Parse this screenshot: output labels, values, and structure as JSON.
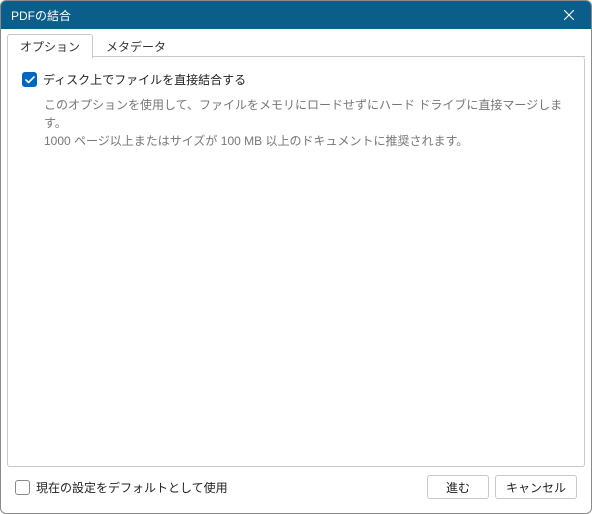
{
  "titlebar": {
    "title": "PDFの結合"
  },
  "tabs": {
    "active": 0,
    "items": [
      {
        "label": "オプション"
      },
      {
        "label": "メタデータ"
      }
    ]
  },
  "options": {
    "direct_merge": {
      "checked": true,
      "label": "ディスク上でファイルを直接結合する",
      "desc_line1": "このオプションを使用して、ファイルをメモリにロードせずにハード ドライブに直接マージします。",
      "desc_line2": "1000 ページ以上またはサイズが 100 MB 以上のドキュメントに推奨されます。"
    }
  },
  "footer": {
    "save_default": {
      "checked": false,
      "label": "現在の設定をデフォルトとして使用"
    },
    "proceed_label": "進む",
    "cancel_label": "キャンセル"
  }
}
